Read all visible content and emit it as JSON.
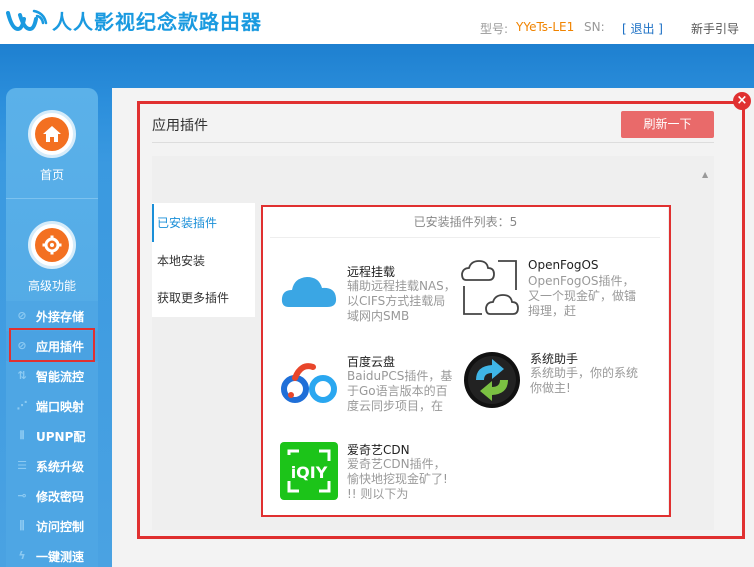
{
  "header": {
    "brand": "人人影视纪念款路由器",
    "model_label": "型号:",
    "model_value": "YYeTs-LE1",
    "sn_label": "SN:",
    "logout": "[ 退出 ]",
    "guide": "新手引导"
  },
  "sidebar": {
    "home_label": "首页",
    "advanced_label": "高级功能",
    "items": [
      {
        "label": "外接存储"
      },
      {
        "label": "应用插件"
      },
      {
        "label": "智能流控"
      },
      {
        "label": "端口映射"
      },
      {
        "label": "UPNP配"
      },
      {
        "label": "系统升级"
      },
      {
        "label": "修改密码"
      },
      {
        "label": "访问控制"
      },
      {
        "label": "一键测速"
      }
    ]
  },
  "panel": {
    "title": "应用插件",
    "refresh": "刷新一下",
    "close": "×"
  },
  "tabs": [
    {
      "label": "已安装插件"
    },
    {
      "label": "本地安装"
    },
    {
      "label": "获取更多插件"
    }
  ],
  "plugins_header": "已安装插件列表：5",
  "plugins": [
    {
      "name": "远程挂载",
      "desc": "辅助远程挂载NAS，以CIFS方式挂载局域网内SMB"
    },
    {
      "name": "OpenFogOS",
      "desc": "OpenFogOS插件，又一个现金矿，做镭拇理，赶"
    },
    {
      "name": "百度云盘",
      "desc": "BaiduPCS插件，基于Go语言版本的百度云同步项目，在"
    },
    {
      "name": "系统助手",
      "desc": "系统助手，你的系统你做主!"
    },
    {
      "name": "爱奇艺CDN",
      "desc": "爱奇艺CDN插件，愉快地挖现金矿了! !! 则以下为"
    }
  ]
}
